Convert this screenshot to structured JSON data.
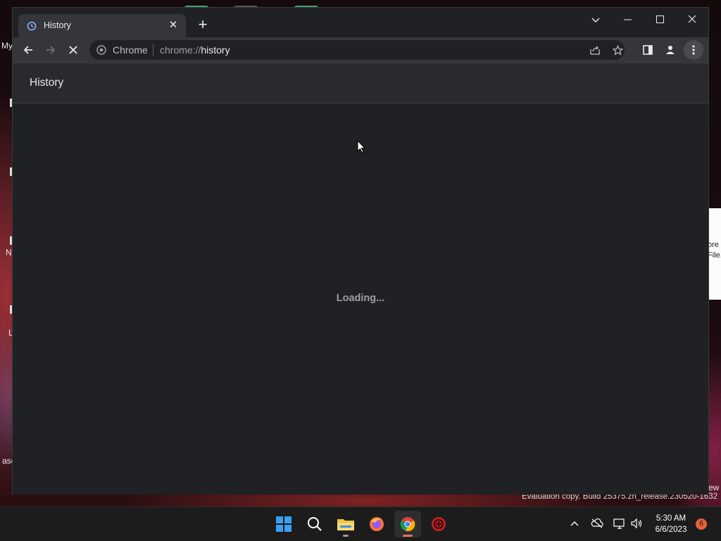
{
  "desktop": {
    "fragments": [
      "My",
      "N",
      "L",
      "asc",
      "ew"
    ],
    "dialog_fragment": [
      "ore",
      "File."
    ],
    "watermark": "Evaluation copy. Build 25375.zn_release.230520-1632"
  },
  "browser": {
    "tab": {
      "title": "History",
      "favicon": "history-icon"
    },
    "omnibox": {
      "site_chip": "Chrome",
      "url_scheme": "chrome://",
      "url_path": "history"
    },
    "page": {
      "title": "History",
      "status": "Loading..."
    }
  },
  "taskbar": {
    "apps": [
      "start",
      "search",
      "file-explorer",
      "firefox",
      "chrome",
      "app"
    ],
    "clock": {
      "time": "5:30 AM",
      "date": "6/6/2023"
    },
    "notification_count": "6"
  },
  "colors": {
    "window_bg": "#202124",
    "toolbar_bg": "#35363a",
    "header_bg": "#292a2d",
    "accent_notification": "#e3623a"
  }
}
